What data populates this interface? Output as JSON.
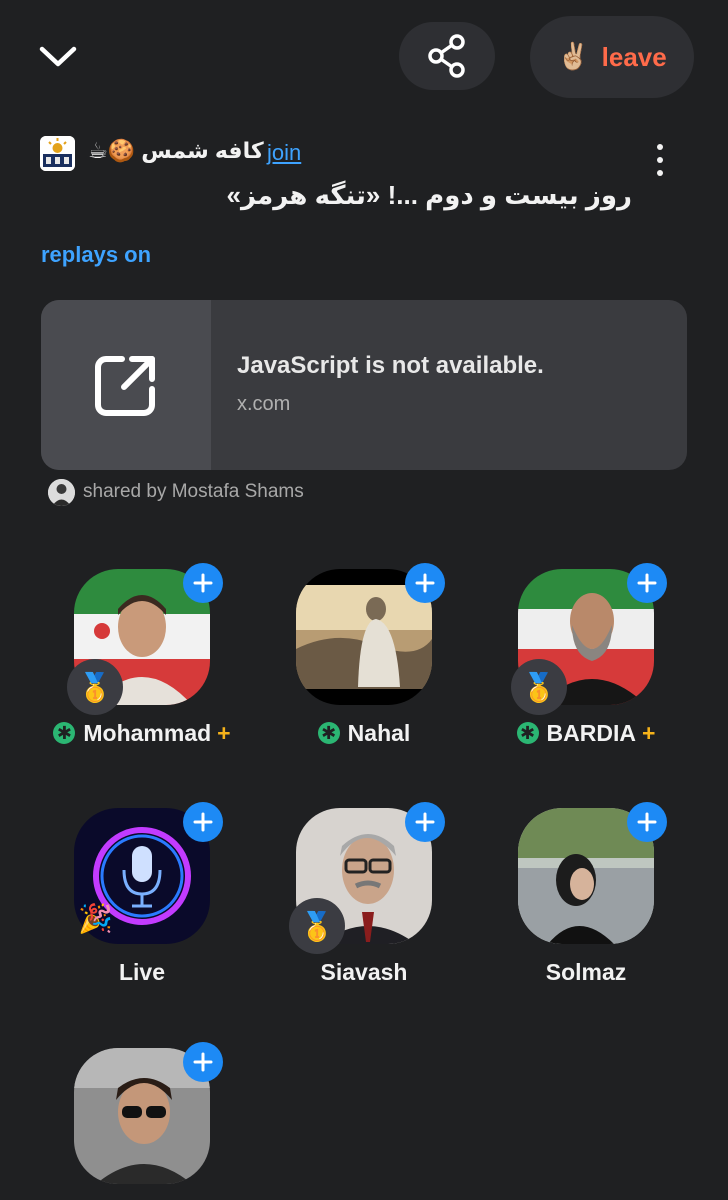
{
  "header": {
    "leave_emoji": "✌🏼",
    "leave_label": "leave"
  },
  "room": {
    "club_name": "کافه شمس 🍪☕",
    "join_label": "join",
    "title": "روز بیست و دوم ...! «تنگه هرمز»",
    "replays_label": "replays on"
  },
  "shared_link": {
    "title": "JavaScript is not available.",
    "domain": "x.com",
    "shared_by": "shared by Mostafa Shams"
  },
  "speakers": [
    {
      "name": "Mohammad",
      "moderator": true,
      "plus": "+",
      "medal": "🥇"
    },
    {
      "name": "Nahal",
      "moderator": true,
      "plus": "",
      "medal": ""
    },
    {
      "name": "BARDIA",
      "moderator": true,
      "plus": "+",
      "medal": "🥇"
    },
    {
      "name": "Live",
      "moderator": false,
      "plus": "",
      "medal": ""
    },
    {
      "name": "Siavash",
      "moderator": false,
      "plus": "",
      "medal": "🥇"
    },
    {
      "name": "Solmaz",
      "moderator": false,
      "plus": "",
      "medal": ""
    },
    {
      "name": "",
      "moderator": false,
      "plus": "",
      "medal": ""
    }
  ],
  "colors": {
    "background": "#1f2022",
    "accent_blue": "#1d8af5",
    "leave_red": "#ff6b4a",
    "moderator_green": "#2bb673",
    "plus_gold": "#f5b21a"
  },
  "icons": {
    "collapse": "chevron-down-icon",
    "share": "share-icon",
    "more": "kebab-menu-icon",
    "external": "external-link-icon",
    "follow": "plus-icon"
  }
}
